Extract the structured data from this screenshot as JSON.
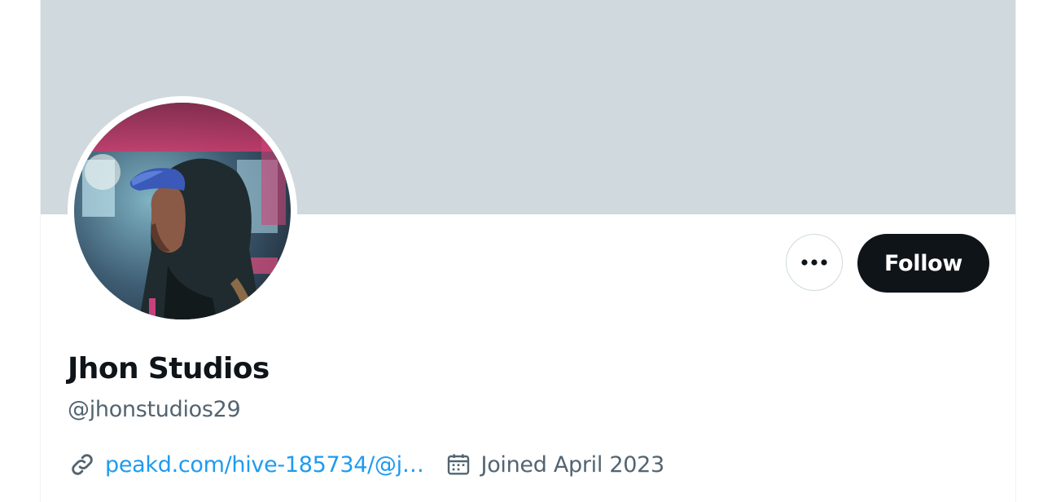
{
  "profile": {
    "display_name": "Jhon Studios",
    "handle": "@jhonstudios29",
    "url_text": "peakd.com/hive-185734/@j…",
    "joined_text": "Joined April 2023"
  },
  "actions": {
    "follow_label": "Follow",
    "more_icon": "more-horizontal-icon"
  },
  "icons": {
    "link": "link-icon",
    "calendar": "calendar-icon"
  },
  "colors": {
    "banner": "#cfd9de",
    "follow_bg": "#0f1419",
    "link": "#1d9bf0",
    "secondary_text": "#536471"
  }
}
